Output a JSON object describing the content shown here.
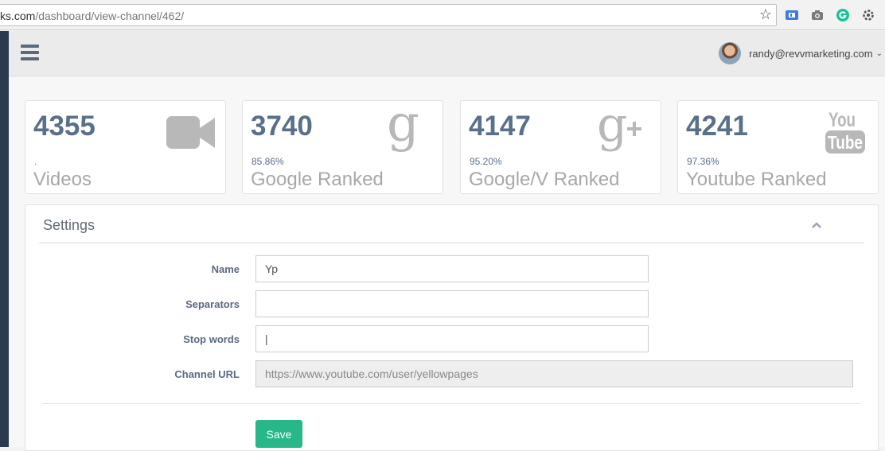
{
  "browser": {
    "url_prefix": "ks.com",
    "url_path": "/dashboard/view-channel/462/",
    "bookmark_icon": "star-icon",
    "extensions": [
      "reader-extension-icon",
      "camera-icon",
      "grammarly-icon",
      "settings-extension-icon"
    ]
  },
  "header": {
    "menu_icon": "hamburger-icon",
    "user_email": "randy@revvmarketing.com",
    "caret": "⌄"
  },
  "stats": [
    {
      "value": "4355",
      "percent": ".",
      "label": "Videos",
      "icon": "video-camera-icon"
    },
    {
      "value": "3740",
      "percent": "85.86%",
      "label": "Google Ranked",
      "icon": "google-icon"
    },
    {
      "value": "4147",
      "percent": "95.20%",
      "label": "Google/V Ranked",
      "icon": "google-plus-icon"
    },
    {
      "value": "4241",
      "percent": "97.36%",
      "label": "Youtube Ranked",
      "icon": "youtube-icon"
    }
  ],
  "settings": {
    "title": "Settings",
    "collapse_icon": "chevron-up-icon",
    "fields": {
      "name": {
        "label": "Name",
        "value": "Yp"
      },
      "separators": {
        "label": "Separators",
        "value": ""
      },
      "stop_words": {
        "label": "Stop words",
        "value": "|"
      },
      "channel_url": {
        "label": "Channel URL",
        "value": "https://www.youtube.com/user/yellowpages"
      }
    },
    "save_label": "Save"
  },
  "colors": {
    "accent_text": "#5a6f8a",
    "muted_label": "#a8a8a8",
    "save_button": "#27b788",
    "rail": "#2b3a4f"
  }
}
